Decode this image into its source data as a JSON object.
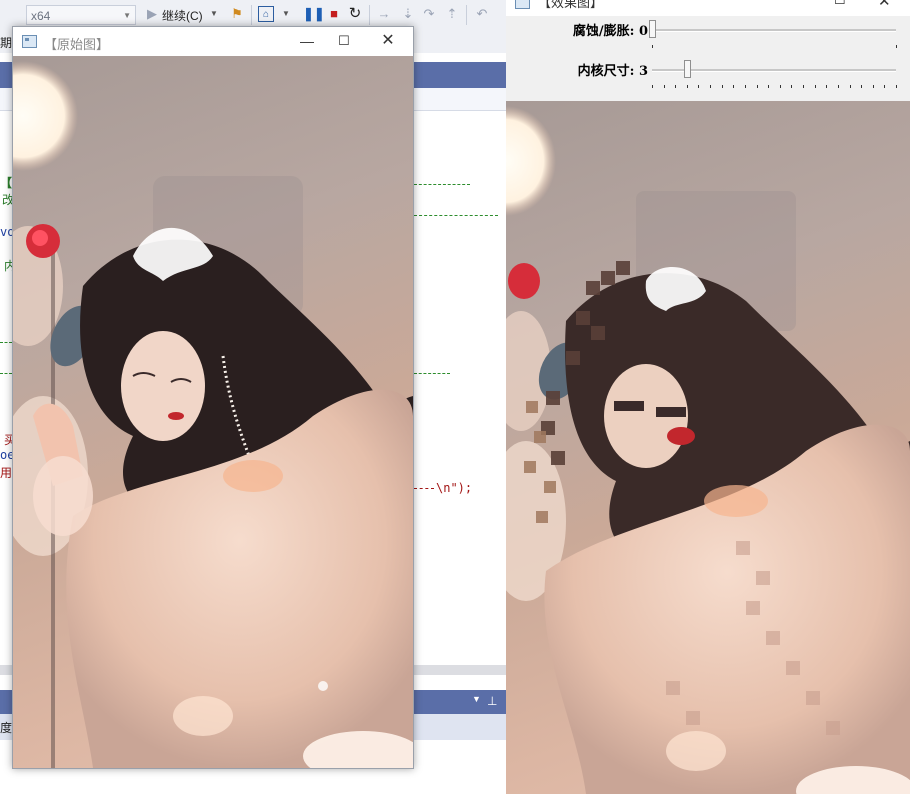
{
  "ide": {
    "platform_combo": "x64",
    "continue_label": "继续(C)",
    "code_fragments": [
      {
        "text": "【",
        "color": "#2b7d2b"
      },
      {
        "text": "改",
        "color": "#2b7d2b"
      },
      {
        "text": "voi",
        "color": "#1f3fa0"
      },
      {
        "text": "内",
        "color": "#2b7d2b"
      },
      {
        "text": "买",
        "color": "#a31515"
      },
      {
        "text": "oe",
        "color": "#1f3fa0"
      },
      {
        "text": "用",
        "color": "#a31515"
      },
      {
        "text": "\\n\");",
        "color": "#a31515"
      }
    ],
    "side_labels": [
      "期",
      "度"
    ]
  },
  "original_window": {
    "title": "【原始图】"
  },
  "effect_window": {
    "title": "【效果图】",
    "trackbars": [
      {
        "label": "腐蚀/膨胀: 0",
        "value": 0,
        "max": 1,
        "ticks": 2
      },
      {
        "label": "内核尺寸: 3",
        "value": 3,
        "max": 21,
        "ticks": 22
      }
    ]
  },
  "colors": {
    "ide_accent": "#5a6ea8",
    "trackbar_bg": "#f0f0f0",
    "code_comment": "#2b7d2b",
    "code_string": "#a31515"
  }
}
